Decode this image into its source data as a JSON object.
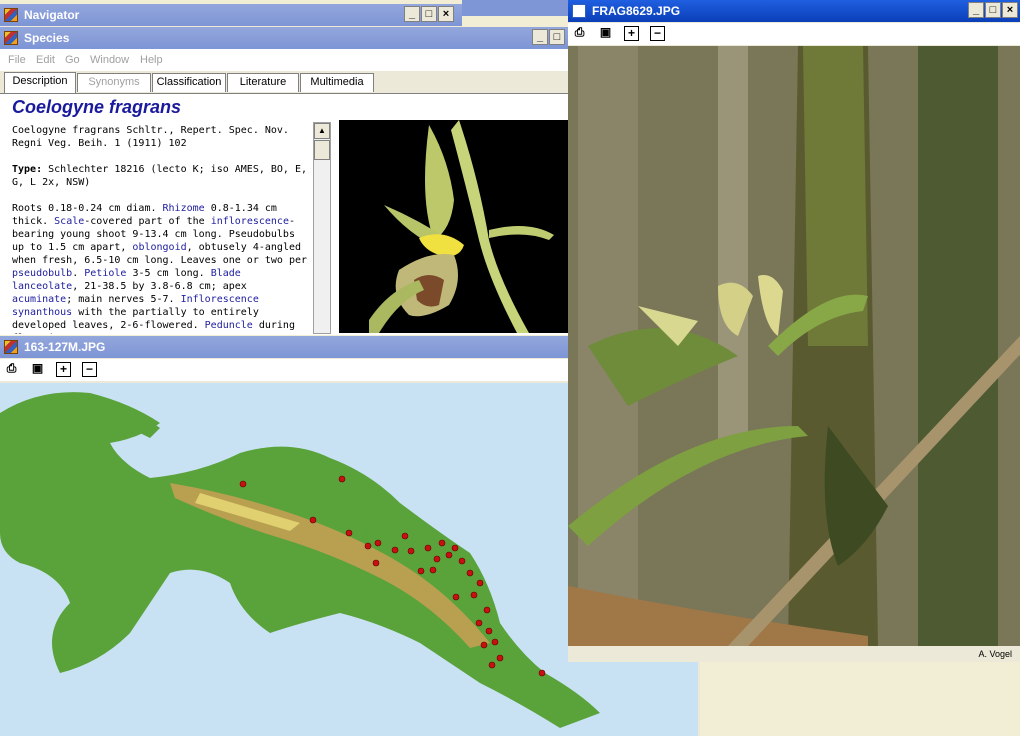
{
  "navigator": {
    "title": "Navigator"
  },
  "species": {
    "title": "Species",
    "menu": [
      "File",
      "Edit",
      "Go",
      "Window",
      "Help"
    ],
    "tabs": [
      "Description",
      "Synonyms",
      "Classification",
      "Literature",
      "Multimedia"
    ],
    "species_name": "Coelogyne fragrans",
    "description": {
      "citation": "Coelogyne fragrans Schltr., Repert. Spec. Nov. Regni Veg. Beih. 1 (1911) 102",
      "type_label": "Type:",
      "type_text": " Schlechter 18216 (lecto K; iso AMES, BO, E, G, L 2x, NSW)",
      "p1": "Roots 0.18-0.24 cm diam. ",
      "l1": "Rhizome",
      "p2": " 0.8-1.34 cm thick. ",
      "l2": "Scale",
      "p3": "-covered part of the ",
      "l3": "inflorescence",
      "p4": "-bearing young shoot 9-13.4 cm long. Pseudobulbs up to 1.5 cm apart, ",
      "l4": "oblongoid",
      "p5": ", obtusely 4-angled when fresh, 6.5-10 cm long. Leaves one or two per ",
      "l5": "pseudobulb",
      "p6": ". ",
      "l6": "Petiole",
      "p7": " 3-5 cm long. ",
      "l7": "Blade lanceolate",
      "p8": ", 21-38.5 by 3.8-6.8 cm; apex ",
      "l8": "acuminate",
      "p9": "; main nerves 5-7. ",
      "l9": "Inflorescence synanthous",
      "p10": " with the partially to entirely developed leaves, 2-6-flowered. ",
      "l10": "Peduncle",
      "p11": " during flowering at"
    }
  },
  "map_window": {
    "title": "163-127M.JPG"
  },
  "photo_window": {
    "title": "FRAG8629.JPG",
    "credit": "A. Vogel"
  },
  "toolbar": {
    "print": "print-icon",
    "save": "save-icon",
    "zoom_in": "+",
    "zoom_out": "−"
  },
  "colors": {
    "title_active": "#0b3fb8",
    "title_inactive": "#7e95d6",
    "link": "#2020a0",
    "species_name": "#1a1a9c"
  }
}
